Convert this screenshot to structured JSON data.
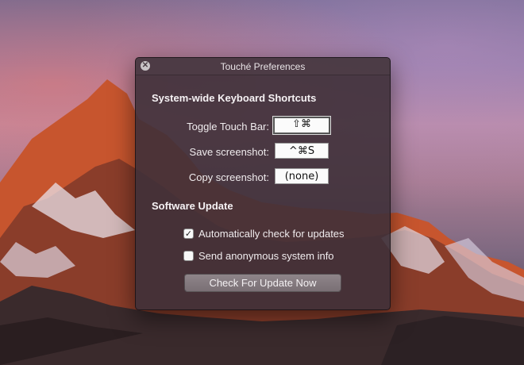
{
  "window": {
    "title": "Touché Preferences",
    "close_icon": "close-icon"
  },
  "shortcuts": {
    "heading": "System-wide Keyboard Shortcuts",
    "rows": [
      {
        "label": "Toggle Touch Bar:",
        "value": "⇧⌘"
      },
      {
        "label": "Save screenshot:",
        "value": "^⌘S"
      },
      {
        "label": "Copy screenshot:",
        "value": "(none)"
      }
    ]
  },
  "software_update": {
    "heading": "Software Update",
    "auto_check": {
      "label": "Automatically check for updates",
      "checked": true,
      "mark": "✓"
    },
    "anon_info": {
      "label": "Send anonymous system info",
      "checked": false,
      "mark": ""
    },
    "button_label": "Check For Update Now"
  },
  "colors": {
    "panel": "#3e3038",
    "text": "#f2eef0"
  }
}
